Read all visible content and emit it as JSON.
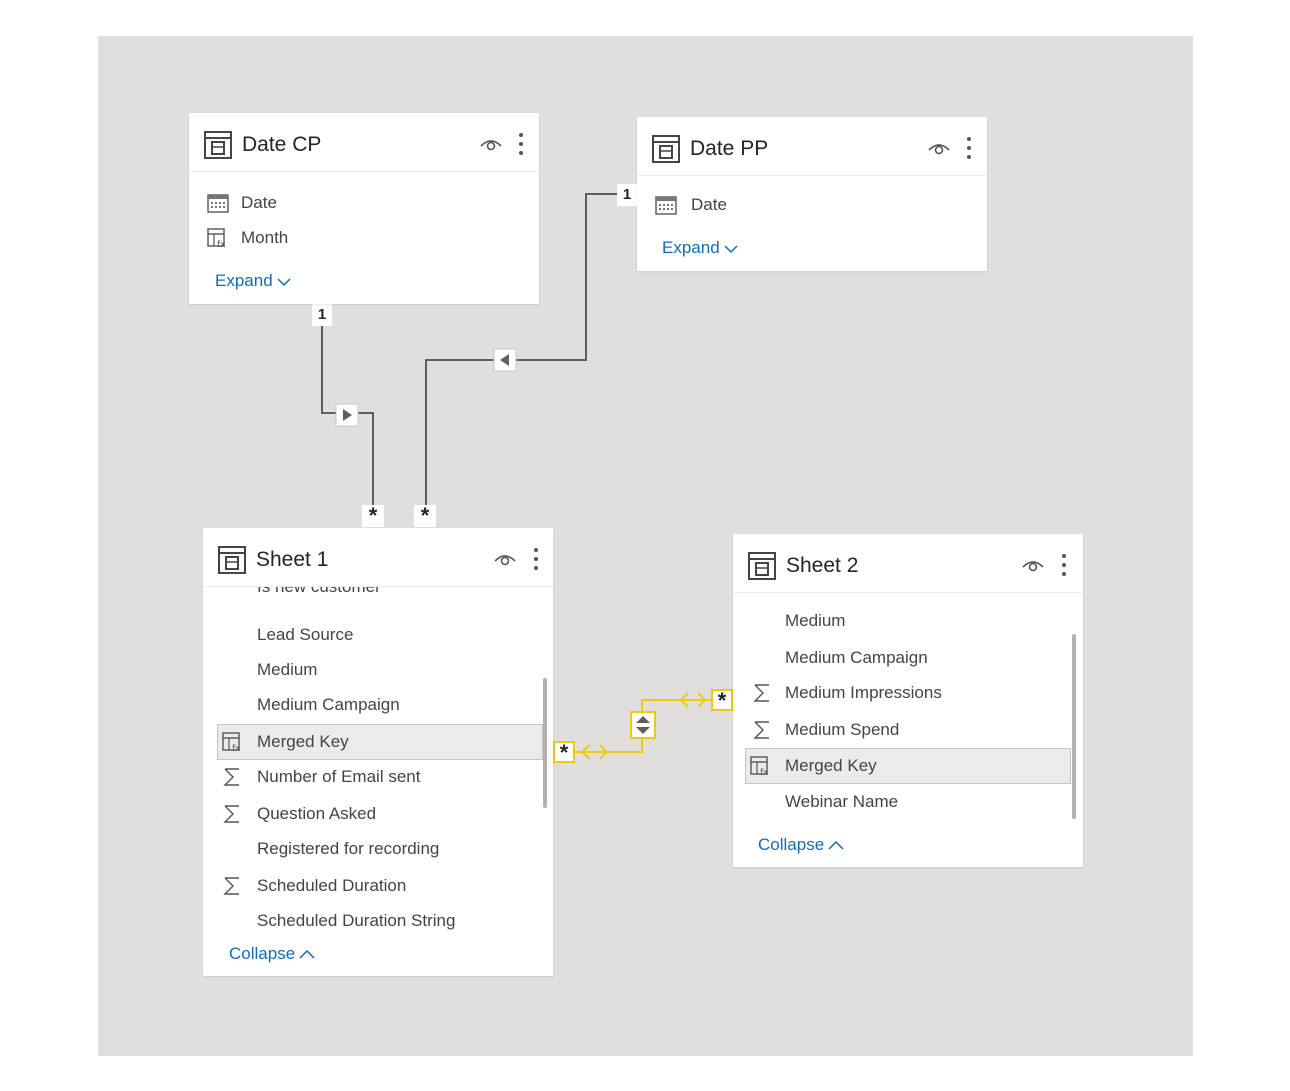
{
  "tables": {
    "date_cp": {
      "title": "Date CP",
      "fields": [
        {
          "label": "Date",
          "icon": "calendar-icon"
        },
        {
          "label": "Month",
          "icon": "calculated-column-icon"
        }
      ],
      "toggle_label": "Expand"
    },
    "date_pp": {
      "title": "Date PP",
      "fields": [
        {
          "label": "Date",
          "icon": "calendar-icon"
        }
      ],
      "toggle_label": "Expand"
    },
    "sheet1": {
      "title": "Sheet 1",
      "clipped_field": "Is new customer",
      "fields": [
        {
          "label": "Lead Source",
          "icon": ""
        },
        {
          "label": "Medium",
          "icon": ""
        },
        {
          "label": "Medium Campaign",
          "icon": ""
        },
        {
          "label": "Merged Key",
          "icon": "calculated-column-icon",
          "selected": true
        },
        {
          "label": "Number of Email sent",
          "icon": "sigma-icon"
        },
        {
          "label": "Question Asked",
          "icon": "sigma-icon"
        },
        {
          "label": "Registered for recording",
          "icon": ""
        },
        {
          "label": "Scheduled Duration",
          "icon": "sigma-icon"
        },
        {
          "label": "Scheduled Duration String",
          "icon": ""
        }
      ],
      "toggle_label": "Collapse"
    },
    "sheet2": {
      "title": "Sheet 2",
      "fields": [
        {
          "label": "Medium",
          "icon": ""
        },
        {
          "label": "Medium Campaign",
          "icon": ""
        },
        {
          "label": "Medium Impressions",
          "icon": "sigma-icon"
        },
        {
          "label": "Medium Spend",
          "icon": "sigma-icon"
        },
        {
          "label": "Merged Key",
          "icon": "calculated-column-icon",
          "selected": true
        },
        {
          "label": "Webinar Name",
          "icon": ""
        }
      ],
      "toggle_label": "Collapse"
    }
  },
  "relationships": {
    "one_label": "1",
    "many_label": "*"
  },
  "colors": {
    "canvas": "#e1dfdd",
    "link": "#0f6cbd",
    "relationship_line": "#605e5c",
    "highlighted_relationship": "#f2c811"
  }
}
